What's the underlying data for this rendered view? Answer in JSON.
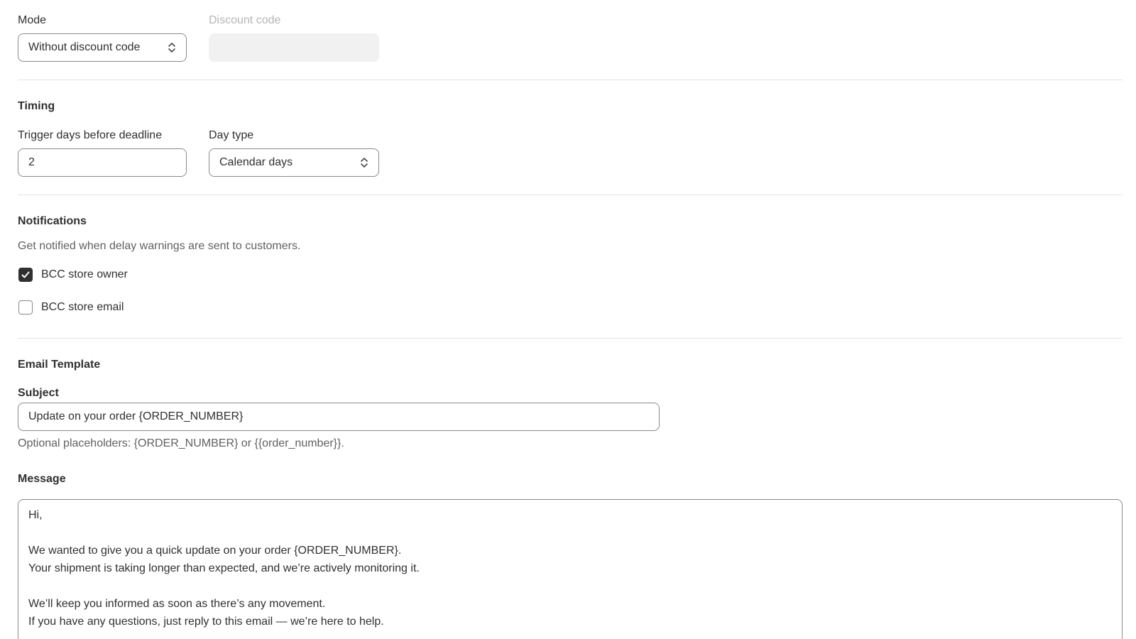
{
  "mode": {
    "label": "Mode",
    "value": "Without discount code"
  },
  "discount": {
    "label": "Discount code",
    "value": ""
  },
  "timing": {
    "heading": "Timing",
    "trigger_label": "Trigger days before deadline",
    "trigger_value": "2",
    "daytype_label": "Day type",
    "daytype_value": "Calendar days"
  },
  "notifications": {
    "heading": "Notifications",
    "description": "Get notified when delay warnings are sent to customers.",
    "bcc_owner_label": "BCC store owner",
    "bcc_owner_checked": true,
    "bcc_email_label": "BCC store email",
    "bcc_email_checked": false
  },
  "email_template": {
    "heading": "Email Template",
    "subject_label": "Subject",
    "subject_value": "Update on your order {ORDER_NUMBER}",
    "subject_help": "Optional placeholders: {ORDER_NUMBER} or {{order_number}}.",
    "message_label": "Message",
    "message_lines": [
      "Hi,",
      "",
      "We wanted to give you a quick update on your order {ORDER_NUMBER}.",
      "Your shipment is taking longer than expected, and we’re actively monitoring it.",
      "",
      "We’ll keep you informed as soon as there’s any movement.",
      "If you have any questions, just reply to this email — we’re here to help."
    ]
  },
  "icons": {
    "select_chevron": "chevron-up-down-icon",
    "checkmark": "checkmark-icon"
  },
  "colors": {
    "text": "#303030",
    "muted_text": "#616161",
    "disabled_label": "#b5b5b5",
    "border": "#8a8a8a",
    "divider": "#e3e3e3",
    "checkbox_checked": "#303030",
    "disabled_field": "#f1f1f1"
  }
}
